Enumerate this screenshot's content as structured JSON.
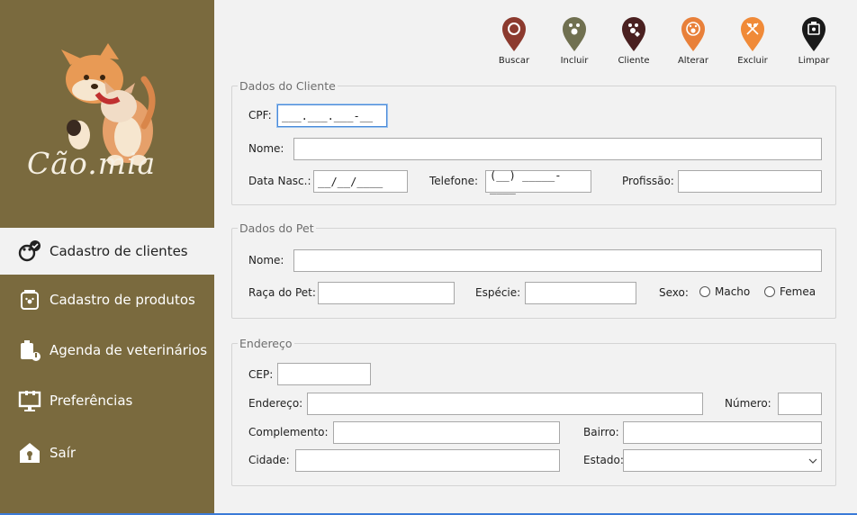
{
  "brand": {
    "logo_text": "Cão.mia"
  },
  "sidebar": {
    "items": [
      {
        "label": "Cadastro de clientes",
        "icon": "pet-client-icon"
      },
      {
        "label": "Cadastro de produtos",
        "icon": "product-box-icon"
      },
      {
        "label": "Agenda de veterinários",
        "icon": "schedule-icon"
      },
      {
        "label": "Preferências",
        "icon": "monitor-settings-icon"
      },
      {
        "label": "Saír",
        "icon": "house-exit-icon"
      }
    ]
  },
  "toolbar": {
    "buscar": "Buscar",
    "incluir": "Incluir",
    "cliente": "Cliente",
    "alterar": "Alterar",
    "excluir": "Excluir",
    "limpar": "Limpar"
  },
  "cliente": {
    "legend": "Dados do Cliente",
    "cpf_label": "CPF:",
    "cpf_value": "___.___.___-__",
    "nome_label": "Nome:",
    "nome_value": "",
    "nasc_label": "Data Nasc.:",
    "nasc_value": "__/__/____",
    "telefone_label": "Telefone:",
    "telefone_value": "(__) _____-____",
    "profissao_label": "Profissão:",
    "profissao_value": ""
  },
  "pet": {
    "legend": "Dados do Pet",
    "nome_label": "Nome:",
    "nome_value": "",
    "raca_label": "Raça do Pet:",
    "raca_value": "",
    "especie_label": "Espécie:",
    "especie_value": "",
    "sexo_label": "Sexo:",
    "macho_label": "Macho",
    "femea_label": "Femea"
  },
  "endereco": {
    "legend": "Endereço",
    "cep_label": "CEP:",
    "cep_value": "",
    "endereco_label": "Endereço:",
    "endereco_value": "",
    "numero_label": "Número:",
    "numero_value": "",
    "complemento_label": "Complemento:",
    "complemento_value": "",
    "bairro_label": "Bairro:",
    "bairro_value": "",
    "cidade_label": "Cidade:",
    "cidade_value": "",
    "estado_label": "Estado:",
    "estado_value": ""
  },
  "colors": {
    "sidebar_bg": "#7a6a3e",
    "buscar_pin": "#8c3a2e",
    "incluir_pin": "#707050",
    "cliente_pin": "#4a2020",
    "alterar_pin": "#e8803a",
    "excluir_pin": "#f08a38",
    "limpar_pin": "#1a1a1a"
  }
}
